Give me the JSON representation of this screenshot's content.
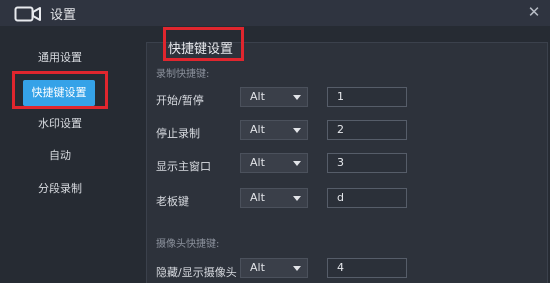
{
  "window": {
    "title": "设置",
    "icon": "video-camera-icon",
    "close_icon": "close-icon",
    "close_glyph": "✕"
  },
  "sidebar": {
    "items": [
      {
        "label": "通用设置"
      },
      {
        "label": "快捷键设置",
        "active": true
      },
      {
        "label": "水印设置"
      },
      {
        "label": "自动"
      },
      {
        "label": "分段录制"
      }
    ]
  },
  "main": {
    "section_title": "快捷键设置",
    "record_group": {
      "title": "录制快捷键:",
      "rows": [
        {
          "label": "开始/暂停",
          "modifier": "Alt",
          "key": "1"
        },
        {
          "label": "停止录制",
          "modifier": "Alt",
          "key": "2"
        },
        {
          "label": "显示主窗口",
          "modifier": "Alt",
          "key": "3"
        },
        {
          "label": "老板键",
          "modifier": "Alt",
          "key": "d"
        }
      ]
    },
    "camera_group": {
      "title": "摄像头快捷键:",
      "rows": [
        {
          "label": "隐藏/显示摄像头",
          "modifier": "Alt",
          "key": "4"
        }
      ]
    }
  },
  "colors": {
    "accent": "#35a2e8",
    "highlight": "#e0262e",
    "background": "#262b33",
    "panel": "#2d323b"
  }
}
